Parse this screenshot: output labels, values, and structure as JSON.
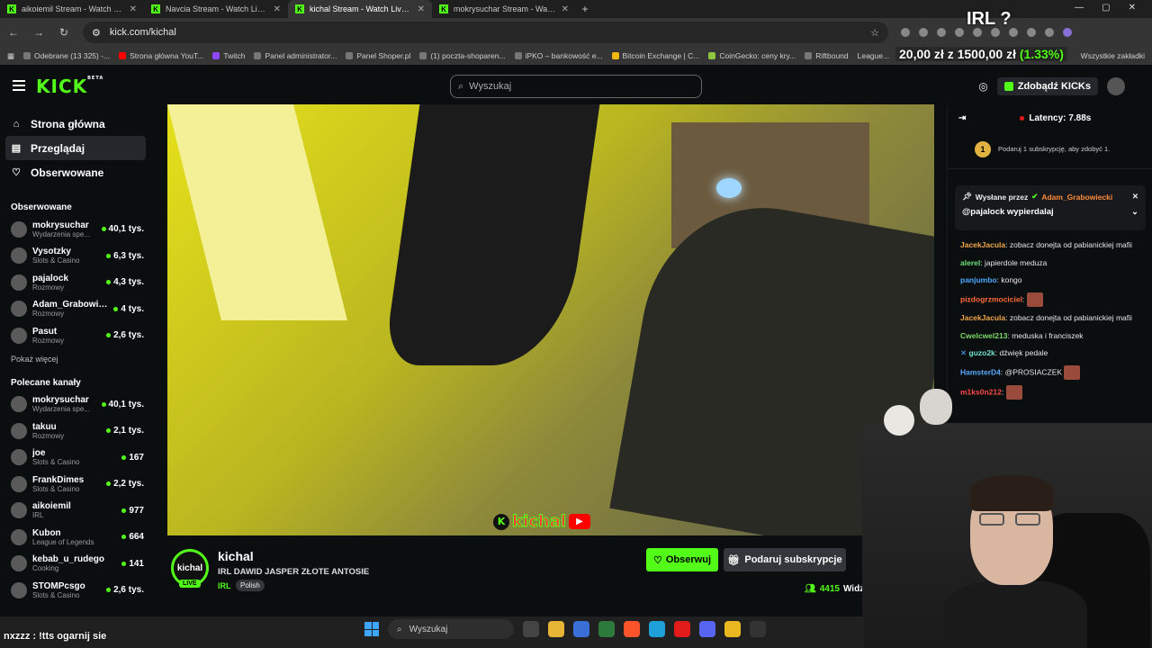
{
  "browser": {
    "tabs": [
      {
        "title": "aikoiemil Stream - Watch Live o",
        "active": false
      },
      {
        "title": "Navcia Stream - Watch Live on",
        "active": false
      },
      {
        "title": "kichal Stream - Watch Live on K",
        "active": true
      },
      {
        "title": "mokrysuchar Stream - Watch L",
        "active": false
      }
    ],
    "url": "kick.com/kichal",
    "bookmarks": [
      "Odebrane (13 325) -...",
      "Strona główna YouT...",
      "Twitch",
      "Panel administrator...",
      "Panel Shoper.pl",
      "(1) poczta-shoparen...",
      "iPKO – bankowość e...",
      "Bitcoin Exchange | C...",
      "CoinGecko: ceny kry...",
      "Riftbound",
      "League..."
    ],
    "all_bookmarks": "Wszystkie zakładki"
  },
  "overlay": {
    "title": "IRL ?",
    "price_a": "20,00 zł",
    "price_sep": "z",
    "price_b": "1500,00 zł",
    "price_pct": "(1.33%)"
  },
  "kick": {
    "logo": "KICK",
    "logo_sup": "BETA",
    "search_placeholder": "Wyszukaj",
    "get_kicks": "Zdobądź KICKs",
    "nav": [
      {
        "label": "Strona główna",
        "icon": "home-icon"
      },
      {
        "label": "Przeglądaj",
        "icon": "browse-icon"
      },
      {
        "label": "Obserwowane",
        "icon": "heart-icon"
      }
    ],
    "followed_title": "Obserwowane",
    "followed": [
      {
        "name": "mokrysuchar",
        "category": "Wydarzenia spe...",
        "viewers": "40,1 tys."
      },
      {
        "name": "Vysotzky",
        "category": "Slots & Casino",
        "viewers": "6,3 tys."
      },
      {
        "name": "pajalock",
        "category": "Rozmowy",
        "viewers": "4,3 tys."
      },
      {
        "name": "Adam_Grabowie...",
        "category": "Rozmowy",
        "viewers": "4 tys."
      },
      {
        "name": "Pasut",
        "category": "Rozmowy",
        "viewers": "2,6 tys."
      }
    ],
    "show_more": "Pokaż więcej",
    "recommended_title": "Polecane kanały",
    "recommended": [
      {
        "name": "mokrysuchar",
        "category": "Wydarzenia spe...",
        "viewers": "40,1 tys."
      },
      {
        "name": "takuu",
        "category": "Rozmowy",
        "viewers": "2,1 tys."
      },
      {
        "name": "joe",
        "category": "Slots & Casino",
        "viewers": "167"
      },
      {
        "name": "FrankDimes",
        "category": "Slots & Casino",
        "viewers": "2,2 tys."
      },
      {
        "name": "aikoiemil",
        "category": "IRL",
        "viewers": "977"
      },
      {
        "name": "Kubon",
        "category": "League of Legends",
        "viewers": "664"
      },
      {
        "name": "kebab_u_rudego",
        "category": "Cooking",
        "viewers": "141"
      },
      {
        "name": "STOMPcsgo",
        "category": "Slots & Casino",
        "viewers": "2,6 tys."
      }
    ],
    "stream": {
      "channel": "kichal",
      "avatar_text": "kichal",
      "live": "LIVE",
      "title": "IRL DAWID JASPER ZŁOTE ANTOSIE",
      "category": "IRL",
      "tag": "Polish",
      "follow": "Obserwuj",
      "subscribe": "Podaruj subskrypcje",
      "viewers": "4415",
      "viewers_label": "Widz",
      "watermark": "kichal"
    },
    "chat": {
      "latency": "Latency: 7.88s",
      "promo_badge": "1",
      "promo": "Podaruj 1 subskrypcję, aby zdobyć 1.",
      "pinned_by_label": "Wysłane przez",
      "pinned_by": "Adam_Grabowiecki",
      "pinned_msg": "@pajalock wypierdalaj",
      "messages": [
        {
          "user": "JacekJacula",
          "color": "#f2a64a",
          "text": "zobacz donejta od pabianickiej mafii"
        },
        {
          "user": "alerel",
          "color": "#6fe07a",
          "text": "japierdole meduza"
        },
        {
          "user": "panjumbo",
          "color": "#4aa8ff",
          "text": "kongo"
        },
        {
          "user": "pizdogrzmociciel",
          "color": "#ff6a3d",
          "text": "",
          "emote": true
        },
        {
          "user": "JacekJacula",
          "color": "#f2a64a",
          "text": "zobacz donejta od pabianickiej mafii"
        },
        {
          "user": "Cwelcwel213",
          "color": "#7bd86a",
          "text": "meduska i franciszek"
        },
        {
          "user": "guzo2k",
          "color": "#6fe0d0",
          "text": "dźwięk pedale"
        },
        {
          "user": "HamsterD4",
          "color": "#59a8ff",
          "text": "@PROSIACZEK",
          "emote": true
        },
        {
          "user": "m1ks0n212",
          "color": "#ff4a4a",
          "text": "",
          "emote": true
        }
      ]
    }
  },
  "obs_chat": "nxzzz : !tts ogarnij sie",
  "taskbar_search": "Wyszukaj",
  "colors": {
    "accent": "#53fc18",
    "bg": "#0b0e0f"
  }
}
